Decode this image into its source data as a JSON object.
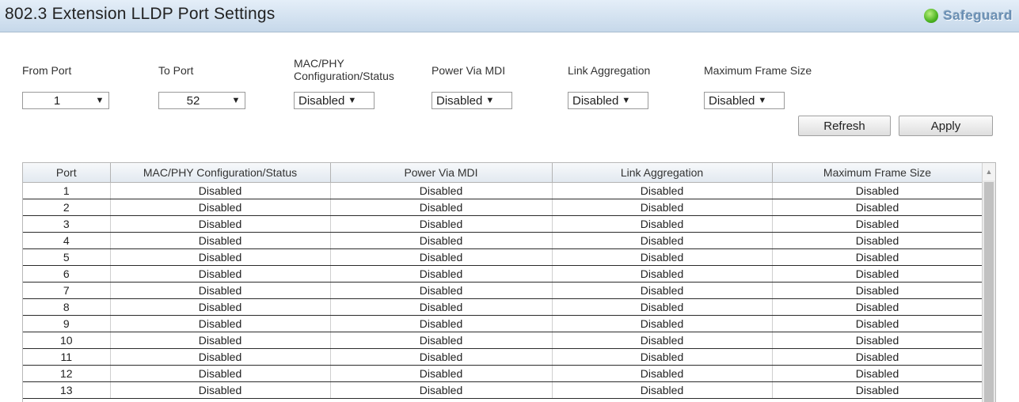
{
  "header": {
    "title": "802.3 Extension LLDP Port Settings",
    "safeguard_label": "Safeguard",
    "safeguard_color": "#4cb321"
  },
  "form": {
    "from_port": {
      "label": "From Port",
      "value": "1"
    },
    "to_port": {
      "label": "To Port",
      "value": "52"
    },
    "mac_phy": {
      "label_line1": "MAC/PHY",
      "label_line2": "Configuration/Status",
      "value": "Disabled"
    },
    "power_via_mdi": {
      "label": "Power Via MDI",
      "value": "Disabled"
    },
    "link_aggregation": {
      "label": "Link Aggregation",
      "value": "Disabled"
    },
    "max_frame_size": {
      "label": "Maximum Frame Size",
      "value": "Disabled"
    },
    "refresh_label": "Refresh",
    "apply_label": "Apply"
  },
  "table": {
    "columns": [
      "Port",
      "MAC/PHY Configuration/Status",
      "Power Via MDI",
      "Link Aggregation",
      "Maximum Frame Size"
    ],
    "rows": [
      [
        "1",
        "Disabled",
        "Disabled",
        "Disabled",
        "Disabled"
      ],
      [
        "2",
        "Disabled",
        "Disabled",
        "Disabled",
        "Disabled"
      ],
      [
        "3",
        "Disabled",
        "Disabled",
        "Disabled",
        "Disabled"
      ],
      [
        "4",
        "Disabled",
        "Disabled",
        "Disabled",
        "Disabled"
      ],
      [
        "5",
        "Disabled",
        "Disabled",
        "Disabled",
        "Disabled"
      ],
      [
        "6",
        "Disabled",
        "Disabled",
        "Disabled",
        "Disabled"
      ],
      [
        "7",
        "Disabled",
        "Disabled",
        "Disabled",
        "Disabled"
      ],
      [
        "8",
        "Disabled",
        "Disabled",
        "Disabled",
        "Disabled"
      ],
      [
        "9",
        "Disabled",
        "Disabled",
        "Disabled",
        "Disabled"
      ],
      [
        "10",
        "Disabled",
        "Disabled",
        "Disabled",
        "Disabled"
      ],
      [
        "11",
        "Disabled",
        "Disabled",
        "Disabled",
        "Disabled"
      ],
      [
        "12",
        "Disabled",
        "Disabled",
        "Disabled",
        "Disabled"
      ],
      [
        "13",
        "Disabled",
        "Disabled",
        "Disabled",
        "Disabled"
      ]
    ]
  },
  "icons": {
    "dropdown_arrow": "▼",
    "scroll_up_arrow": "▲"
  }
}
